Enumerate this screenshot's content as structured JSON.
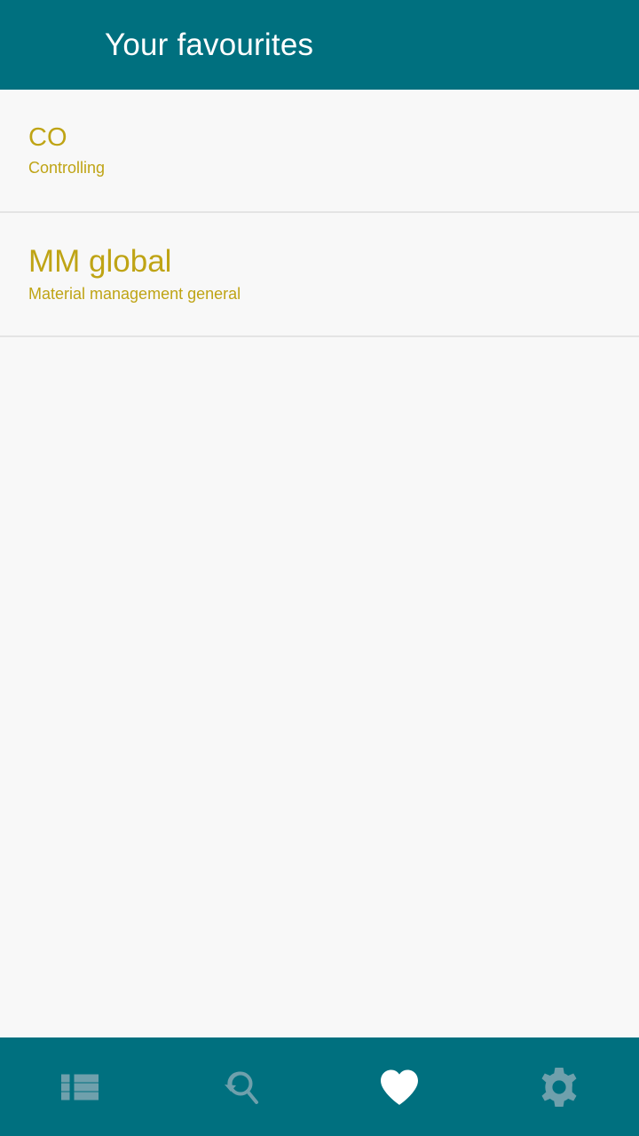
{
  "app_bar": {
    "title": "Your favourites",
    "background_color": "#00707f",
    "title_color": "#ffffff"
  },
  "list": {
    "accent_color": "#bfa415",
    "background_color": "#f8f8f8",
    "divider_color": "#e4e4e4",
    "items": [
      {
        "title": "CO",
        "subtitle": "Controlling"
      },
      {
        "title": "MM global",
        "subtitle": "Material management general"
      }
    ]
  },
  "bottom_nav": {
    "background_color": "#00707f",
    "active_color": "#ffffff",
    "inactive_color": "#6fa0ac",
    "tabs": [
      {
        "icon": "list-icon",
        "label": "",
        "active": false
      },
      {
        "icon": "search-history-icon",
        "label": "",
        "active": false
      },
      {
        "icon": "heart-icon",
        "label": "",
        "active": true
      },
      {
        "icon": "gear-icon",
        "label": "",
        "active": false
      }
    ]
  }
}
